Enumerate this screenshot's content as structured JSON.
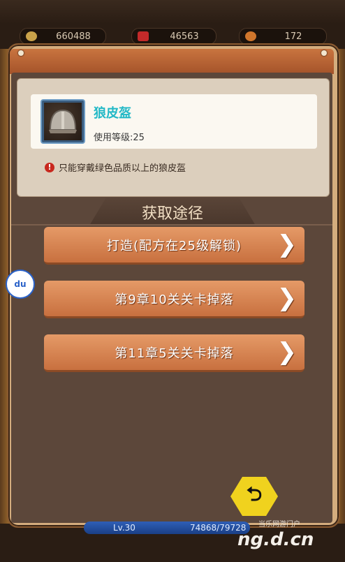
{
  "resources": {
    "gold": "660488",
    "gems": "46563",
    "energy": "172"
  },
  "item": {
    "name": "狼皮盔",
    "level_text": "使用等级:25",
    "restriction": "只能穿戴绿色品质以上的狼皮盔"
  },
  "section_title": "获取途径",
  "routes": [
    {
      "label": "打造(配方在25级解锁)"
    },
    {
      "label": "第9章10关关卡掉落"
    },
    {
      "label": "第11章5关关卡掉落"
    }
  ],
  "player": {
    "level": "Lv.30",
    "exp": "74868/79728"
  },
  "floating_button": {
    "label": "du"
  },
  "watermark": {
    "text": "当乐网游门户",
    "logo": "ng.d.cn"
  },
  "colors": {
    "item_name": "#21b8c6",
    "route_button": "#d98450",
    "back_button": "#f0d21e"
  }
}
